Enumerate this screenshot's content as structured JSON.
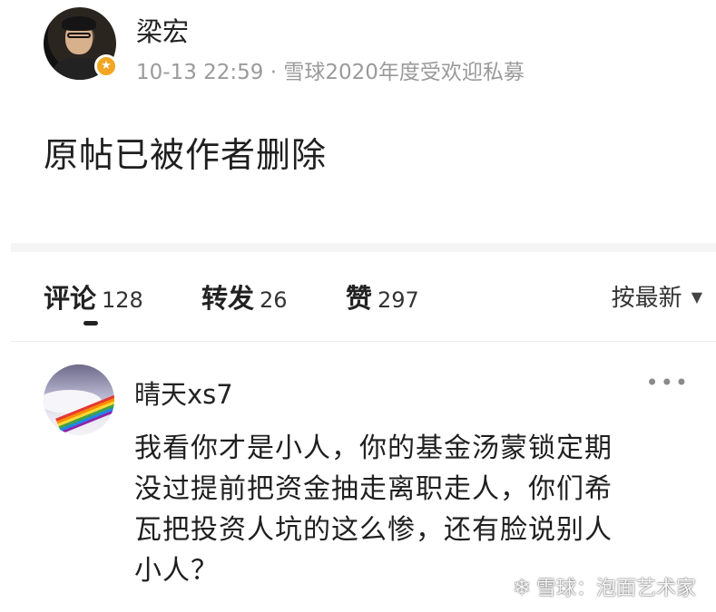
{
  "post": {
    "author": "梁宏",
    "meta": "10-13 22:59 · 雪球2020年度受欢迎私募",
    "body": "原帖已被作者删除",
    "badge_icon": "star-badge-icon",
    "badge_color": "#f2a623"
  },
  "tabs": {
    "comments_label": "评论",
    "comments_count": "128",
    "reposts_label": "转发",
    "reposts_count": "26",
    "likes_label": "赞",
    "likes_count": "297",
    "sort_label": "按最新",
    "sort_icon": "caret-down-icon"
  },
  "comment": {
    "user": "晴天xs7",
    "more_icon": "more-dots-icon",
    "lines": [
      "我看你才是小人，你的基金汤蒙锁定期",
      "没过提前把资金抽走离职走人，你们希",
      "瓦把投资人坑的这么惨，还有脸说别人",
      "小人？"
    ]
  },
  "watermark": {
    "icon": "snowball-logo-icon",
    "text": "雪球：泡面艺术家"
  }
}
